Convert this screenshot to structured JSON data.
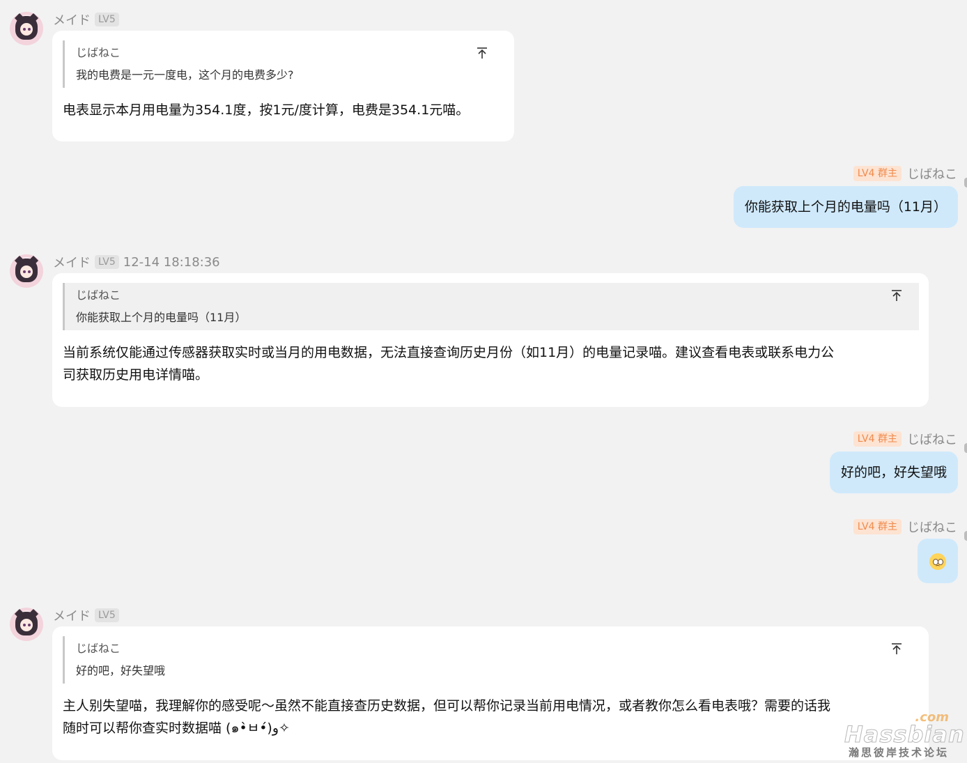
{
  "messages": [
    {
      "sender": "メイド",
      "level": "LV5",
      "time": "",
      "quote_author": "じばねこ",
      "quote_text": "我的电费是一元一度电，这个月的电费多少?",
      "text": "电表显示本月用电量为354.1度，按1元/度计算，电费是354.1元喵。"
    },
    {
      "sender": "じばねこ",
      "level": "LV4 群主",
      "text": "你能获取上个月的电量吗（11月）"
    },
    {
      "sender": "メイド",
      "level": "LV5",
      "time": "12-14 18:18:36",
      "quote_author": "じばねこ",
      "quote_text": "你能获取上个月的电量吗（11月）",
      "text_line1": "当前系统仅能通过传感器获取实时或当月的用电数据，无法直接查询历史月份（如11月）的电量记录喵。建议查看电表或联系电力公",
      "text_line2": "司获取历史用电详情喵。"
    },
    {
      "sender": "じばねこ",
      "level": "LV4 群主",
      "text": "好的吧，好失望哦"
    },
    {
      "sender": "じばねこ",
      "level": "LV4 群主",
      "emoji": "pleading-face"
    },
    {
      "sender": "メイド",
      "level": "LV5",
      "time": "",
      "quote_author": "じばねこ",
      "quote_text": "好的吧，好失望哦",
      "text_line1": "主人别失望喵，我理解你的感受呢～虽然不能直接查历史数据，但可以帮你记录当前用电情况，或者教你怎么看电表哦？需要的话我",
      "text_line2": "随时可以帮你查实时数据喵 (๑•̀ㅂ•́)و✧"
    }
  ],
  "watermark": {
    "suffix": ".com",
    "logo": "Hassbian",
    "tagline": "瀚思彼岸技术论坛"
  },
  "colors": {
    "background": "#f2f2f2",
    "incoming_bubble": "#ffffff",
    "outgoing_bubble": "#cfe9fb",
    "owner_badge_bg": "#fde3d2",
    "owner_badge_text": "#f08a4b"
  }
}
